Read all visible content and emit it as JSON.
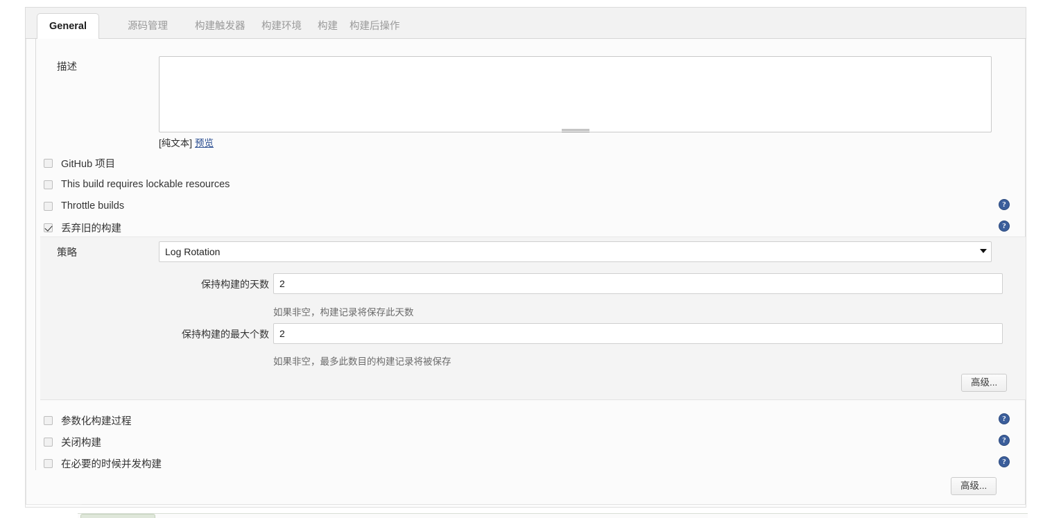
{
  "tabs": [
    {
      "label": "General",
      "active": true
    },
    {
      "label": "源码管理",
      "active": false
    },
    {
      "label": "构建触发器",
      "active": false
    },
    {
      "label": "构建环境",
      "active": false
    },
    {
      "label": "构建",
      "active": false
    },
    {
      "label": "构建后操作",
      "active": false
    }
  ],
  "description": {
    "label": "描述",
    "value": "",
    "placeholder": "",
    "plain_text_note": "[纯文本]",
    "preview_link": "预览"
  },
  "checkboxes": [
    {
      "label": "GitHub 项目",
      "checked": false,
      "has_help": false
    },
    {
      "label": "This build requires lockable resources",
      "checked": false,
      "has_help": false
    },
    {
      "label": "Throttle builds",
      "checked": false,
      "has_help": true
    },
    {
      "label": "丢弃旧的构建",
      "checked": true,
      "has_help": true
    }
  ],
  "log_rotation": {
    "strategy_label": "策略",
    "strategy_value": "Log Rotation",
    "strategy_options": [
      "Log Rotation"
    ],
    "fields": [
      {
        "label": "保持构建的天数",
        "value": "2",
        "hint": "如果非空，构建记录将保存此天数"
      },
      {
        "label": "保持构建的最大个数",
        "value": "2",
        "hint": "如果非空，最多此数目的构建记录将被保存"
      }
    ],
    "advanced_label": "高级..."
  },
  "bottom_checkboxes": [
    {
      "label": "参数化构建过程",
      "checked": false,
      "has_help": true
    },
    {
      "label": "关闭构建",
      "checked": false,
      "has_help": true
    },
    {
      "label": "在必要的时候并发构建",
      "checked": false,
      "has_help": true
    }
  ],
  "bottom_advanced_label": "高级...",
  "colors": {
    "accent_link": "#274b8f",
    "help_icon": "#3b5e9b",
    "active_tab_bg": "#ffffff",
    "panel_bg": "#f4f4f4"
  }
}
